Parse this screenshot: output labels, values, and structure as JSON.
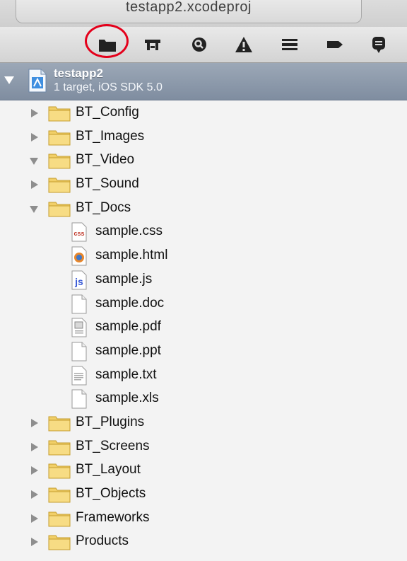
{
  "window": {
    "tab_title": "testapp2.xcodeproj"
  },
  "navigator": {
    "buttons": [
      {
        "name": "project-navigator-button",
        "icon": "folder-icon",
        "selected": true
      },
      {
        "name": "symbol-navigator-button",
        "icon": "hierarchy-icon"
      },
      {
        "name": "search-navigator-button",
        "icon": "magnifier-icon"
      },
      {
        "name": "issue-navigator-button",
        "icon": "warning-icon"
      },
      {
        "name": "debug-navigator-button",
        "icon": "list-icon"
      },
      {
        "name": "breakpoint-navigator-button",
        "icon": "breakpoint-icon"
      },
      {
        "name": "log-navigator-button",
        "icon": "speech-bubble-icon"
      }
    ],
    "highlight_color": "#e4001b"
  },
  "project": {
    "name": "testapp2",
    "subtitle": "1 target, iOS SDK 5.0"
  },
  "tree": {
    "folders_top": [
      {
        "label": "BT_Config",
        "expanded": false
      },
      {
        "label": "BT_Images",
        "expanded": false
      },
      {
        "label": "BT_Video",
        "expanded": true
      },
      {
        "label": "BT_Sound",
        "expanded": false
      },
      {
        "label": "BT_Docs",
        "expanded": true
      }
    ],
    "files": [
      {
        "label": "sample.css",
        "icon": "css-file-icon"
      },
      {
        "label": "sample.html",
        "icon": "html-file-icon"
      },
      {
        "label": "sample.js",
        "icon": "js-file-icon"
      },
      {
        "label": "sample.doc",
        "icon": "blank-file-icon"
      },
      {
        "label": "sample.pdf",
        "icon": "pdf-file-icon"
      },
      {
        "label": "sample.ppt",
        "icon": "blank-file-icon"
      },
      {
        "label": "sample.txt",
        "icon": "text-file-icon"
      },
      {
        "label": "sample.xls",
        "icon": "blank-file-icon"
      }
    ],
    "folders_bottom": [
      {
        "label": "BT_Plugins",
        "expanded": false
      },
      {
        "label": "BT_Screens",
        "expanded": false
      },
      {
        "label": "BT_Layout",
        "expanded": false
      },
      {
        "label": "BT_Objects",
        "expanded": false
      },
      {
        "label": "Frameworks",
        "expanded": false
      },
      {
        "label": "Products",
        "expanded": false
      }
    ]
  }
}
